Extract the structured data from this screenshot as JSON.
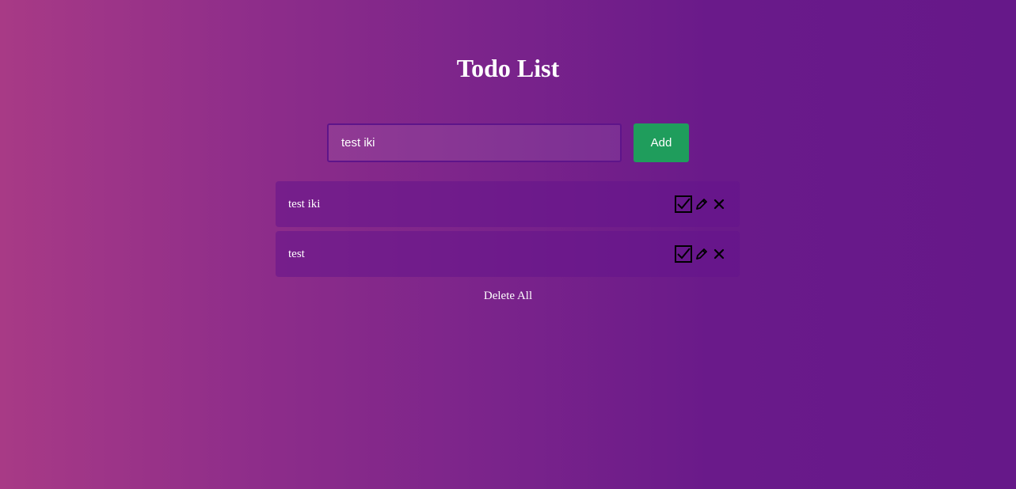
{
  "app": {
    "title": "Todo List"
  },
  "form": {
    "input_value": "test iki",
    "add_label": "Add"
  },
  "todos": [
    {
      "text": "test iki"
    },
    {
      "text": "test"
    }
  ],
  "footer": {
    "delete_all_label": "Delete All"
  },
  "colors": {
    "add_button": "#1f9d5c",
    "input_border": "#5e148a",
    "icon": "#000000"
  },
  "icons": [
    "checkbox-checked-icon",
    "pencil-icon",
    "close-icon"
  ]
}
